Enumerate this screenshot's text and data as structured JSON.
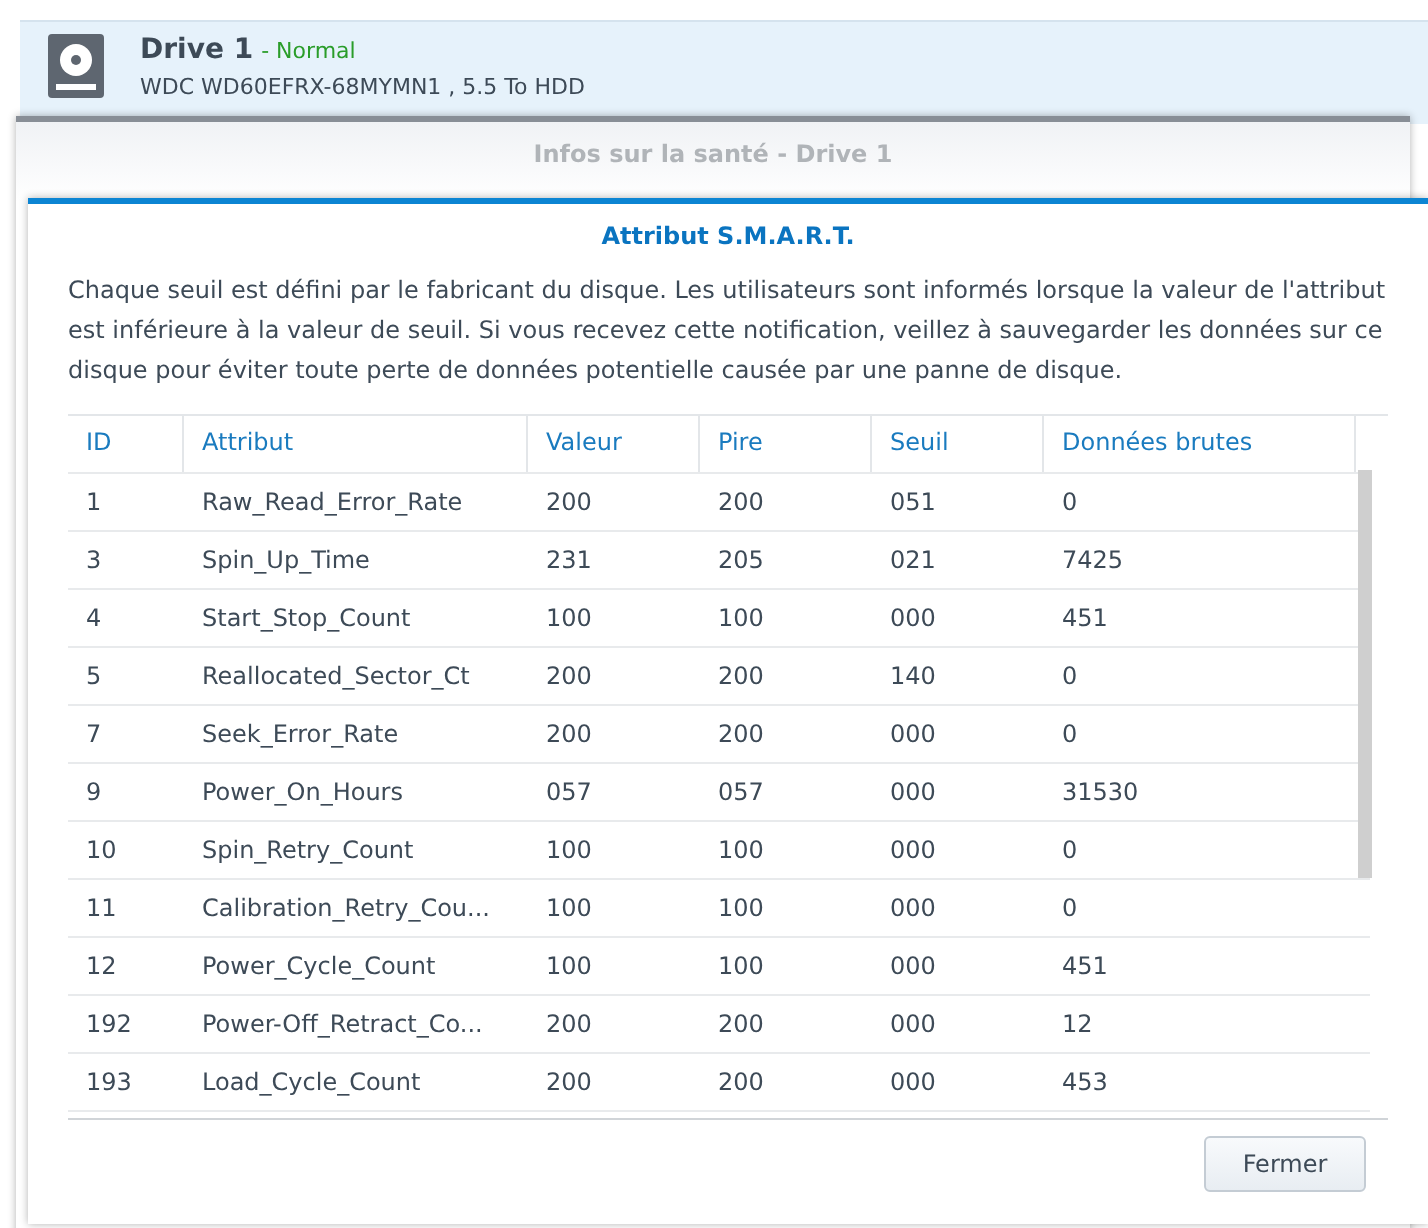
{
  "drive": {
    "name": "Drive 1",
    "status": "- Normal",
    "model": "WDC WD60EFRX-68MYMN1 , 5.5 To HDD"
  },
  "back_dialog": {
    "title": "Infos sur la santé - Drive 1"
  },
  "dialog": {
    "title": "Attribut S.M.A.R.T.",
    "description": "Chaque seuil est défini par le fabricant du disque. Les utilisateurs sont informés lorsque la valeur de l'attribut est inférieure à la valeur de seuil. Si vous recevez cette notification, veillez à sauvegarder les données sur ce disque pour éviter toute perte de données potentielle causée par une panne de disque.",
    "table": {
      "columns": [
        "ID",
        "Attribut",
        "Valeur",
        "Pire",
        "Seuil",
        "Données brutes"
      ],
      "rows": [
        [
          "1",
          "Raw_Read_Error_Rate",
          "200",
          "200",
          "051",
          "0"
        ],
        [
          "3",
          "Spin_Up_Time",
          "231",
          "205",
          "021",
          "7425"
        ],
        [
          "4",
          "Start_Stop_Count",
          "100",
          "100",
          "000",
          "451"
        ],
        [
          "5",
          "Reallocated_Sector_Ct",
          "200",
          "200",
          "140",
          "0"
        ],
        [
          "7",
          "Seek_Error_Rate",
          "200",
          "200",
          "000",
          "0"
        ],
        [
          "9",
          "Power_On_Hours",
          "057",
          "057",
          "000",
          "31530"
        ],
        [
          "10",
          "Spin_Retry_Count",
          "100",
          "100",
          "000",
          "0"
        ],
        [
          "11",
          "Calibration_Retry_Cou...",
          "100",
          "100",
          "000",
          "0"
        ],
        [
          "12",
          "Power_Cycle_Count",
          "100",
          "100",
          "000",
          "451"
        ],
        [
          "192",
          "Power-Off_Retract_Co...",
          "200",
          "200",
          "000",
          "12"
        ],
        [
          "193",
          "Load_Cycle_Count",
          "200",
          "200",
          "000",
          "453"
        ]
      ]
    },
    "buttons": [
      "Fermer"
    ]
  }
}
